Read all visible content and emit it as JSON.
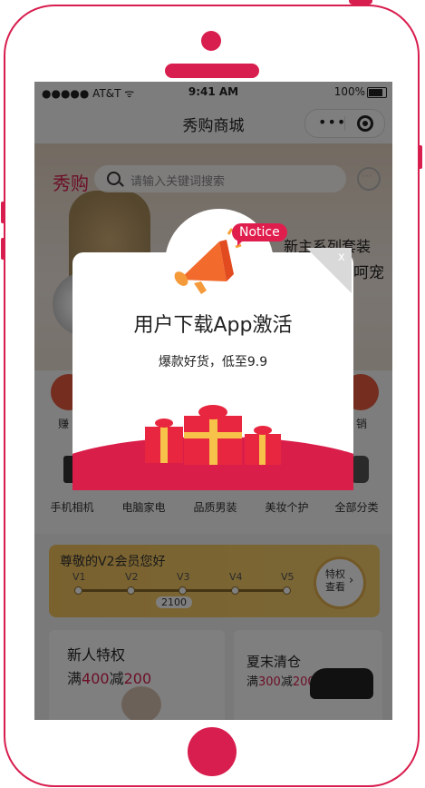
{
  "status_bar": {
    "carrier": "●●●●● AT&T ᯤ",
    "time": "9:41 AM",
    "battery": "100%"
  },
  "nav": {
    "title": "秀购商城",
    "more_icon": "ellipsis-icon",
    "close_icon": "record-circle-icon"
  },
  "header": {
    "logo": "秀购",
    "search_placeholder": "请输入关键词搜索",
    "search_icon": "search-icon",
    "message_icon": "message-icon"
  },
  "banner": {
    "line1": "新主系列套装",
    "line2": "呵宠"
  },
  "round_icons": [
    {
      "label": "赚"
    },
    {
      "label": "销"
    }
  ],
  "categories": [
    {
      "label": "手机相机"
    },
    {
      "label": "电脑家电"
    },
    {
      "label": "品质男装"
    },
    {
      "label": "美妆个护"
    },
    {
      "label": "全部分类"
    }
  ],
  "vip": {
    "title": "尊敬的V2会员您好",
    "levels": [
      "V1",
      "V2",
      "V3",
      "V4",
      "V5"
    ],
    "points": "2100",
    "button_label": "特权查看",
    "button_arrow": "›"
  },
  "cards": [
    {
      "title": "新人特权",
      "prefix": "满",
      "num1": "400",
      "mid": "减",
      "num2": "200"
    },
    {
      "title": "夏末清仓",
      "prefix": "满",
      "num1": "300",
      "mid": "减",
      "num2": "200"
    }
  ],
  "popup": {
    "badge": "Notice",
    "title": "用户下载App激活",
    "subtitle": "爆款好货，低至9.9",
    "close": "x",
    "icon": "megaphone-icon",
    "gift_icon": "gift-boxes-icon"
  },
  "colors": {
    "brand": "#d81e4e",
    "popup_wave": "#da1e4a",
    "vip_gold": "#f3c45d"
  }
}
